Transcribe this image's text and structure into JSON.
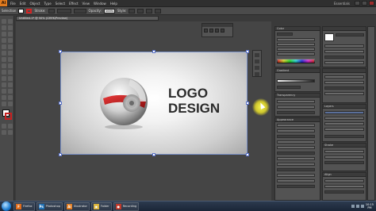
{
  "app": {
    "logo_text": "Ai"
  },
  "menubar": {
    "items": [
      "File",
      "Edit",
      "Object",
      "Type",
      "Select",
      "Effect",
      "View",
      "Window",
      "Help"
    ],
    "workspace": "Essentials"
  },
  "controlbar": {
    "selection_label": "Selection",
    "stroke_label": "Stroke:",
    "opacity_label": "Opacity:",
    "opacity_value": "100%",
    "style_label": "Style:"
  },
  "document": {
    "tab_title": "Untitled-1* @ 50% (CMYK/Preview)"
  },
  "artwork": {
    "line1": "LOGO",
    "line2": "DESIGN",
    "colors": {
      "ring": "#c81e1e",
      "sphere": "#cfcfcf",
      "text": "#2b2b2b"
    }
  },
  "panels": {
    "color_head": "Color",
    "gradient_head": "Gradient",
    "transparency_head": "Transparency",
    "appearance_head": "Appearance",
    "layers_head": "Layers",
    "stroke_head": "Stroke",
    "align_head": "Align"
  },
  "taskbar": {
    "items": [
      {
        "label": "Firefox",
        "color": "#e06b1a",
        "glyph": "F"
      },
      {
        "label": "Photoshop",
        "color": "#1f6fb3",
        "glyph": "Ps"
      },
      {
        "label": "Illustrator",
        "color": "#e07a1e",
        "glyph": "Ai"
      },
      {
        "label": "Folder",
        "color": "#d8b23a",
        "glyph": "▣"
      },
      {
        "label": "Recording",
        "color": "#c0392b",
        "glyph": "●"
      }
    ],
    "clock_time": "10:15",
    "clock_date": "PM"
  }
}
